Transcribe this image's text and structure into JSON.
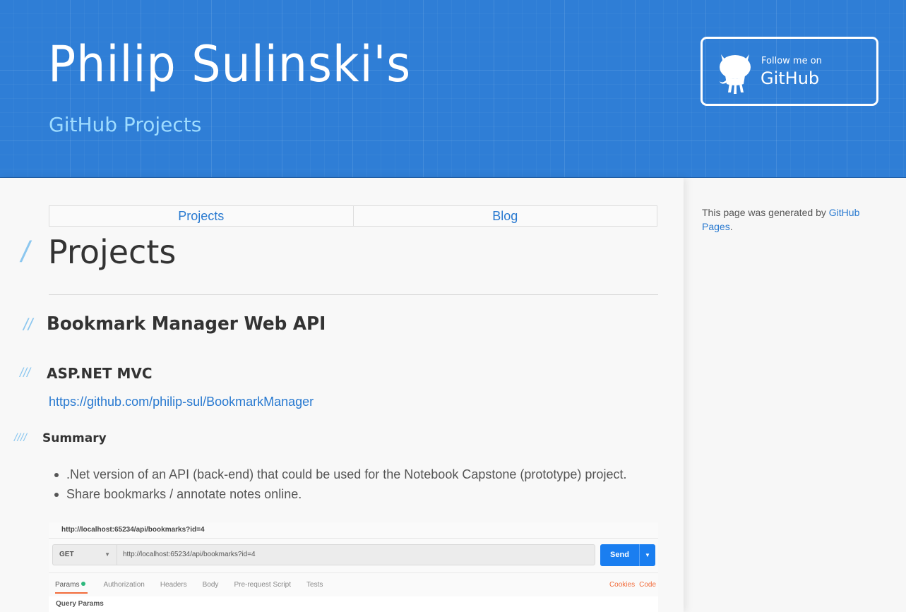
{
  "header": {
    "title": "Philip Sulinski's",
    "subtitle": "GitHub Projects",
    "follow_small": "Follow me on",
    "follow_big": "GitHub"
  },
  "nav": {
    "items": [
      {
        "label": "Projects"
      },
      {
        "label": "Blog"
      }
    ]
  },
  "main": {
    "h1_slashes": "/",
    "h1": "Projects",
    "h2_slashes": "//",
    "h2": "Bookmark Manager Web API",
    "h3_slashes": "///",
    "h3": "ASP.NET MVC",
    "repo_link": "https://github.com/philip-sul/BookmarkManager",
    "h4_slashes": "////",
    "h4": "Summary",
    "bullets": [
      ".Net version of an API (back-end) that could be used for the Notebook Capstone (prototype) project.",
      "Share bookmarks / annotate notes online."
    ]
  },
  "postman": {
    "title_url": "http://localhost:65234/api/bookmarks?id=4",
    "method": "GET",
    "url": "http://localhost:65234/api/bookmarks?id=4",
    "send": "Send",
    "tabs": [
      "Params",
      "Authorization",
      "Headers",
      "Body",
      "Pre-request Script",
      "Tests"
    ],
    "right_links": [
      "Cookies",
      "Code"
    ],
    "query_params": "Query Params",
    "colors": {
      "send": "#1a7ef0",
      "tab_active_underline": "#f26b3a",
      "params_dot": "#2db87d"
    }
  },
  "sidebar": {
    "text": "This page was generated by ",
    "link": "GitHub Pages",
    "end": "."
  },
  "colors": {
    "header_bg": "#2f7ed6",
    "link": "#2879d0",
    "slashes": "#8cc7ef",
    "subtitle": "#9fdcff"
  }
}
